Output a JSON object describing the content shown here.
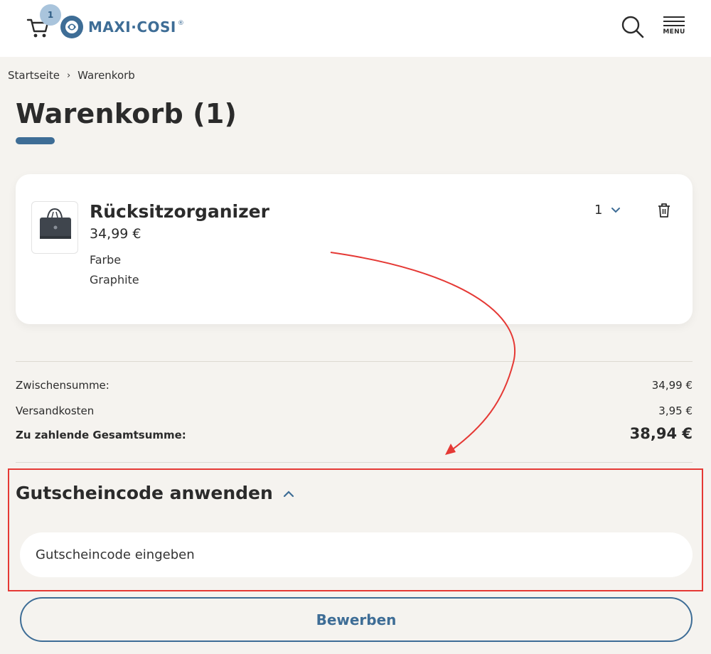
{
  "header": {
    "cart_count": "1",
    "logo_text": "MAXI·COSI",
    "logo_mark": "®",
    "menu_label": "MENU"
  },
  "breadcrumb": {
    "home": "Startseite",
    "separator": "›",
    "current": "Warenkorb"
  },
  "page_title": "Warenkorb (1)",
  "cart_item": {
    "name": "Rücksitzorganizer",
    "price": "34,99 €",
    "attr_label": "Farbe",
    "attr_value": "Graphite",
    "quantity": "1"
  },
  "summary": {
    "subtotal_label": "Zwischensumme:",
    "subtotal_value": "34,99 €",
    "shipping_label": "Versandkosten",
    "shipping_value": "3,95 €",
    "total_label": "Zu zahlende Gesamtsumme:",
    "total_value": "38,94 €"
  },
  "coupon": {
    "title": "Gutscheincode anwenden",
    "placeholder": "Gutscheincode eingeben",
    "apply_label": "Bewerben"
  },
  "colors": {
    "accent": "#3e6d96",
    "annotation": "#e53935",
    "background": "#f5f3ef"
  }
}
